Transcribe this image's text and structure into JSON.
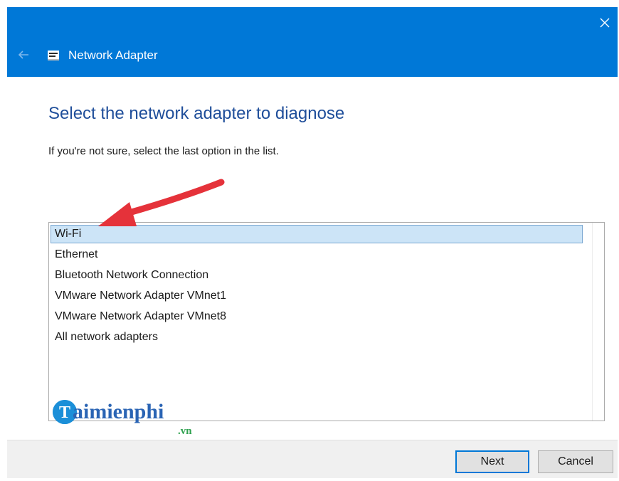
{
  "window": {
    "title": "Network Adapter",
    "title_bar_color": "#0078d7",
    "icons": {
      "back": "back-arrow-icon",
      "app": "network-adapter-icon",
      "close": "close-icon"
    }
  },
  "content": {
    "heading": "Select the network adapter to diagnose",
    "instruction": "If you're not sure, select the last option in the list.",
    "adapters": [
      {
        "label": "Wi-Fi",
        "selected": true
      },
      {
        "label": "Ethernet",
        "selected": false
      },
      {
        "label": "Bluetooth Network Connection",
        "selected": false
      },
      {
        "label": "VMware Network Adapter VMnet1",
        "selected": false
      },
      {
        "label": "VMware Network Adapter VMnet8",
        "selected": false
      },
      {
        "label": "All network adapters",
        "selected": false
      }
    ]
  },
  "watermark": {
    "brand": "aimienphi",
    "logo_letter": "T",
    "domain": ".vn"
  },
  "footer": {
    "next_label": "Next",
    "cancel_label": "Cancel"
  },
  "annotation": {
    "arrow_color": "#e5323a",
    "points_to": "Wi-Fi"
  }
}
